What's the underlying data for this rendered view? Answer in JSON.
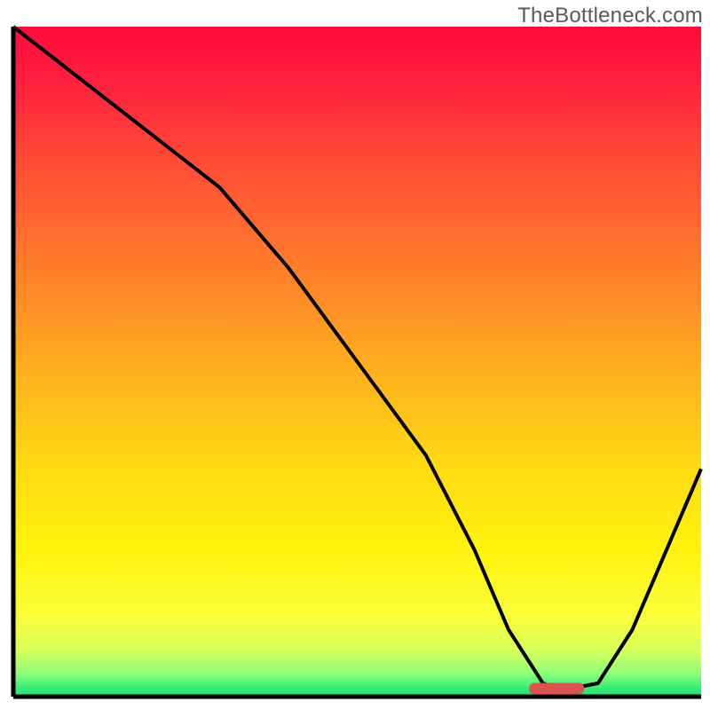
{
  "watermark": "TheBottleneck.com",
  "chart_data": {
    "type": "line",
    "title": "",
    "xlabel": "",
    "ylabel": "",
    "x_range": [
      0,
      100
    ],
    "y_range": [
      0,
      100
    ],
    "series": [
      {
        "name": "bottleneck-curve",
        "x": [
          0,
          10,
          20,
          30,
          40,
          50,
          60,
          67,
          72,
          77,
          80,
          85,
          90,
          95,
          100
        ],
        "y": [
          100,
          92,
          84,
          76,
          64,
          50,
          36,
          22,
          10,
          2,
          1,
          2,
          10,
          22,
          34
        ]
      }
    ],
    "marker": {
      "name": "optimal-range",
      "x_start": 75,
      "x_end": 83,
      "y": 1.2,
      "color": "#d9534f"
    },
    "gradient_stops": [
      {
        "offset": 0.0,
        "color": "#ff0a3c"
      },
      {
        "offset": 0.08,
        "color": "#ff1f3e"
      },
      {
        "offset": 0.2,
        "color": "#ff4b36"
      },
      {
        "offset": 0.35,
        "color": "#ff7a2b"
      },
      {
        "offset": 0.5,
        "color": "#ffab1f"
      },
      {
        "offset": 0.65,
        "color": "#ffd814"
      },
      {
        "offset": 0.78,
        "color": "#fff30c"
      },
      {
        "offset": 0.88,
        "color": "#faff3a"
      },
      {
        "offset": 0.93,
        "color": "#d8ff5a"
      },
      {
        "offset": 0.965,
        "color": "#8fff7a"
      },
      {
        "offset": 0.985,
        "color": "#3fef78"
      },
      {
        "offset": 1.0,
        "color": "#1fdc6e"
      }
    ]
  }
}
